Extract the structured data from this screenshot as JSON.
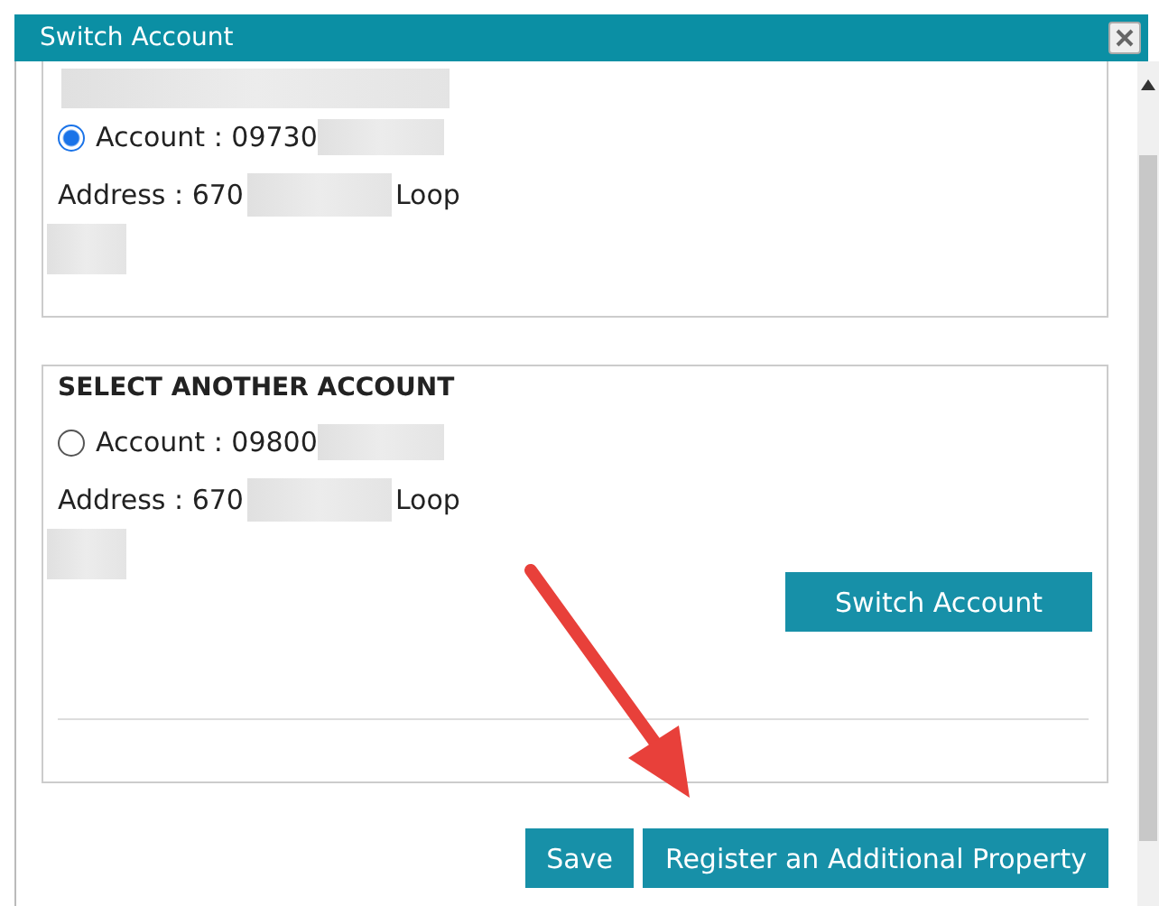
{
  "window": {
    "title": "Switch Account"
  },
  "panels": [
    {
      "account_label": "Account : 09730",
      "address_prefix": "Address : 670",
      "address_suffix": "Loop",
      "selected": true
    },
    {
      "heading": "SELECT ANOTHER ACCOUNT",
      "account_label": "Account : 09800",
      "address_prefix": "Address : 670",
      "address_suffix": "Loop",
      "selected": false,
      "action": "Switch Account"
    }
  ],
  "buttons": [
    {
      "label": "Save"
    },
    {
      "label": "Register an Additional Property"
    }
  ]
}
